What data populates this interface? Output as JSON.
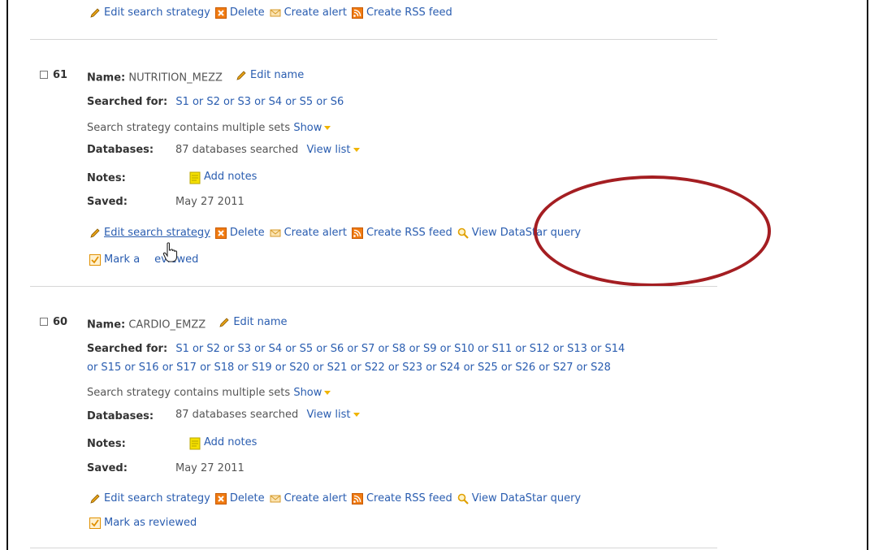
{
  "actions": {
    "edit_strategy": "Edit search strategy",
    "delete": "Delete",
    "create_alert": "Create alert",
    "create_rss": "Create RSS feed",
    "view_datastar": "View DataStar query",
    "mark_reviewed": "Mark as reviewed",
    "mark_reviewed_partial_1": "Mark a",
    "mark_reviewed_partial_2": "eviewed"
  },
  "labels": {
    "name": "Name:",
    "searched_for": "Searched for:",
    "databases": "Databases:",
    "notes": "Notes:",
    "saved": "Saved:",
    "edit_name": "Edit name",
    "strategy_note": "Search strategy contains multiple sets",
    "show": "Show",
    "databases_count": "87 databases searched",
    "view_list": "View list",
    "add_notes": "Add notes"
  },
  "searches": [
    {
      "number": "61",
      "name": "NUTRITION_MEZZ",
      "searched_for": "S1 or S2 or S3 or S4 or S5 or S6",
      "saved": "May 27 2011"
    },
    {
      "number": "60",
      "name": "CARDIO_EMZZ",
      "searched_for_line1": "S1 or S2 or S3 or S4 or S5 or S6 or S7 or S8 or S9 or S10 or S11 or S12 or S13 or S14",
      "searched_for_line2": "or S15 or S16 or S17 or S18 or S19 or S20 or S21 or S22 or S23 or S24 or S25 or S26 or S27 or S28",
      "saved": "May 27 2011"
    }
  ],
  "colors": {
    "link": "#2a5db0",
    "highlight_oval": "#a41e22",
    "accent_orange": "#f0b400"
  }
}
